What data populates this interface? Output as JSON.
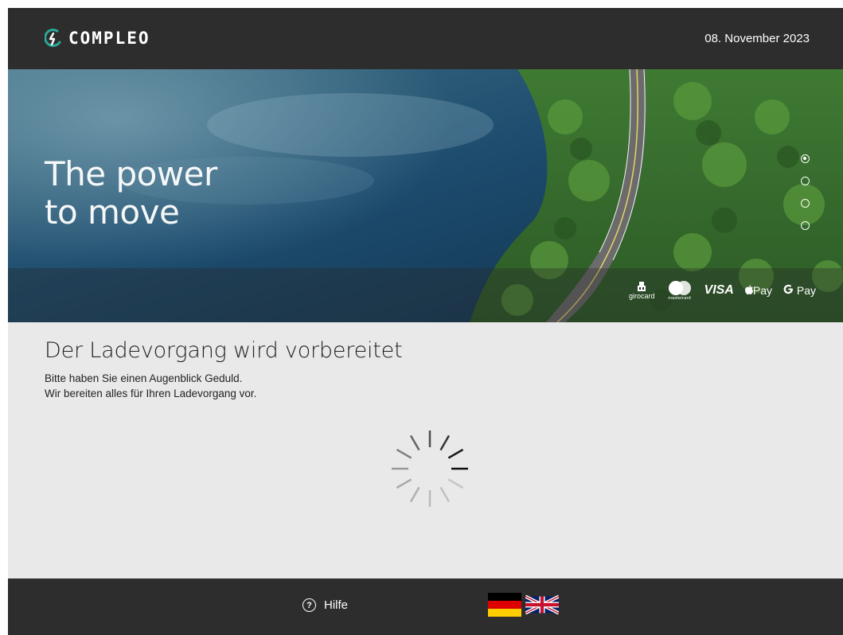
{
  "header": {
    "logo_text": "COMPLEO",
    "date": "08. November 2023",
    "brand_color": "#2aa89a"
  },
  "hero": {
    "headline_line1": "The power",
    "headline_line2": "to move",
    "carousel_dots": 4,
    "carousel_active": 1,
    "payments": {
      "girocard": "girocard",
      "mastercard": "mastercard",
      "visa": "VISA",
      "apple_pay": "Pay",
      "google_pay": "Pay"
    }
  },
  "status": {
    "title": "Der Ladevorgang wird vorbereitet",
    "line1": "Bitte haben Sie einen Augenblick Geduld.",
    "line2": "Wir bereiten alles für Ihren Ladevorgang vor."
  },
  "footer": {
    "help_label": "Hilfe",
    "languages": [
      "de",
      "en"
    ]
  }
}
